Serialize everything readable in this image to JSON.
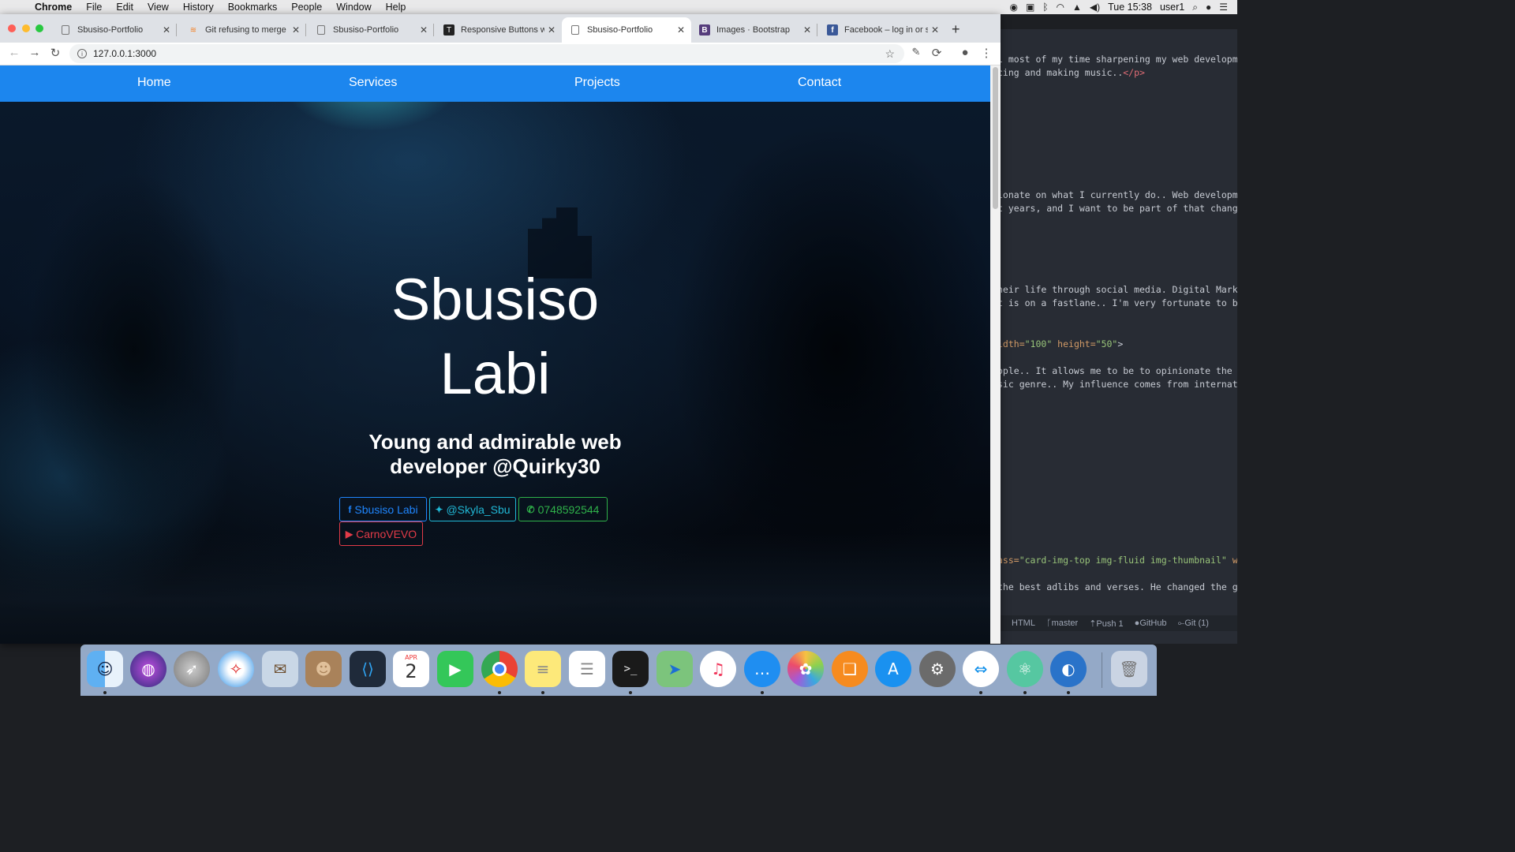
{
  "menubar": {
    "app": "Chrome",
    "menus": [
      "File",
      "Edit",
      "View",
      "History",
      "Bookmarks",
      "People",
      "Window",
      "Help"
    ],
    "clock": "Tue 15:38",
    "user": "user1"
  },
  "tabs": [
    {
      "title": "Sbusiso-Portfolio",
      "favicon": "page-icon"
    },
    {
      "title": "Git refusing to merge u",
      "favicon": "stackoverflow-icon"
    },
    {
      "title": "Sbusiso-Portfolio",
      "favicon": "page-icon"
    },
    {
      "title": "Responsive Buttons wit",
      "favicon": "tutorial-icon"
    },
    {
      "title": "Sbusiso-Portfolio",
      "favicon": "page-icon",
      "active": true
    },
    {
      "title": "Images · Bootstrap",
      "favicon": "bootstrap-icon"
    },
    {
      "title": "Facebook – log in or sig",
      "favicon": "facebook-icon"
    }
  ],
  "address": {
    "url": "127.0.0.1:3000"
  },
  "page": {
    "nav": [
      "Home",
      "Services",
      "Projects",
      "Contact"
    ],
    "name_line1": "Sbusiso",
    "name_line2": "Labi",
    "tagline_line1": "Young and admirable web",
    "tagline_line2": "developer @Quirky30",
    "social": {
      "facebook": "Sbusiso Labi",
      "twitter": "@Skyla_Sbu",
      "whatsapp": "0748592544",
      "youtube": "CarnoVEVO"
    },
    "colors": {
      "nav": "#1c86ee",
      "facebook": "#1f86ff",
      "twitter": "#20b8d6",
      "whatsapp": "#2fb24a",
      "youtube": "#e33b48"
    }
  },
  "editor": {
    "lines": [
      {
        "pre": "l most of my time sharpening my web developm",
        "tag": "",
        "post": ""
      },
      {
        "pre": "cing and making music..",
        "tag": "</p>",
        "post": ""
      },
      {
        "pre": "ionate on what I currently do.. Web developme",
        "tag": "",
        "post": ""
      },
      {
        "pre": "t years, and I want to be part of that chang",
        "tag": "",
        "post": ""
      },
      {
        "pre": "heir life through social media. Digital Mark",
        "tag": "",
        "post": ""
      },
      {
        "pre": "t is on a fastlane.. I'm very fortunate to b",
        "tag": "",
        "post": ""
      },
      {
        "attr1": "idth=",
        "str1": "\"100\"",
        "attr2": " height=",
        "str2": "\"50\"",
        "end": ">"
      },
      {
        "pre": "ople.. It allows me to be to opinionate the ",
        "tag": "",
        "post": ""
      },
      {
        "pre": "sic genre.. My influence comes from internat",
        "tag": "",
        "post": ""
      },
      {
        "attr1": "ass=",
        "str1": "\"card-img-top img-fluid img-thumbnail\"",
        "attr2": " w",
        "str2": "",
        "end": ""
      },
      {
        "pre": "the best adlibs and verses. He changed the g",
        "tag": "",
        "post": ""
      }
    ],
    "status": [
      "HTML",
      "master",
      "Push 1",
      "GitHub",
      "Git (1)"
    ]
  },
  "dock": {
    "apps": [
      "Finder",
      "Siri",
      "Launchpad",
      "Safari",
      "Mail",
      "Contacts",
      "Visual Studio Code",
      "Calendar",
      "FaceTime",
      "Google Chrome",
      "Notes",
      "Reminders",
      "Terminal",
      "Maps",
      "iTunes",
      "Messages",
      "Photos",
      "iBooks",
      "App Store",
      "System Preferences",
      "TeamViewer",
      "Atom",
      "Unknown App",
      "Trash"
    ],
    "calendar_month": "APR",
    "calendar_day": "2"
  }
}
